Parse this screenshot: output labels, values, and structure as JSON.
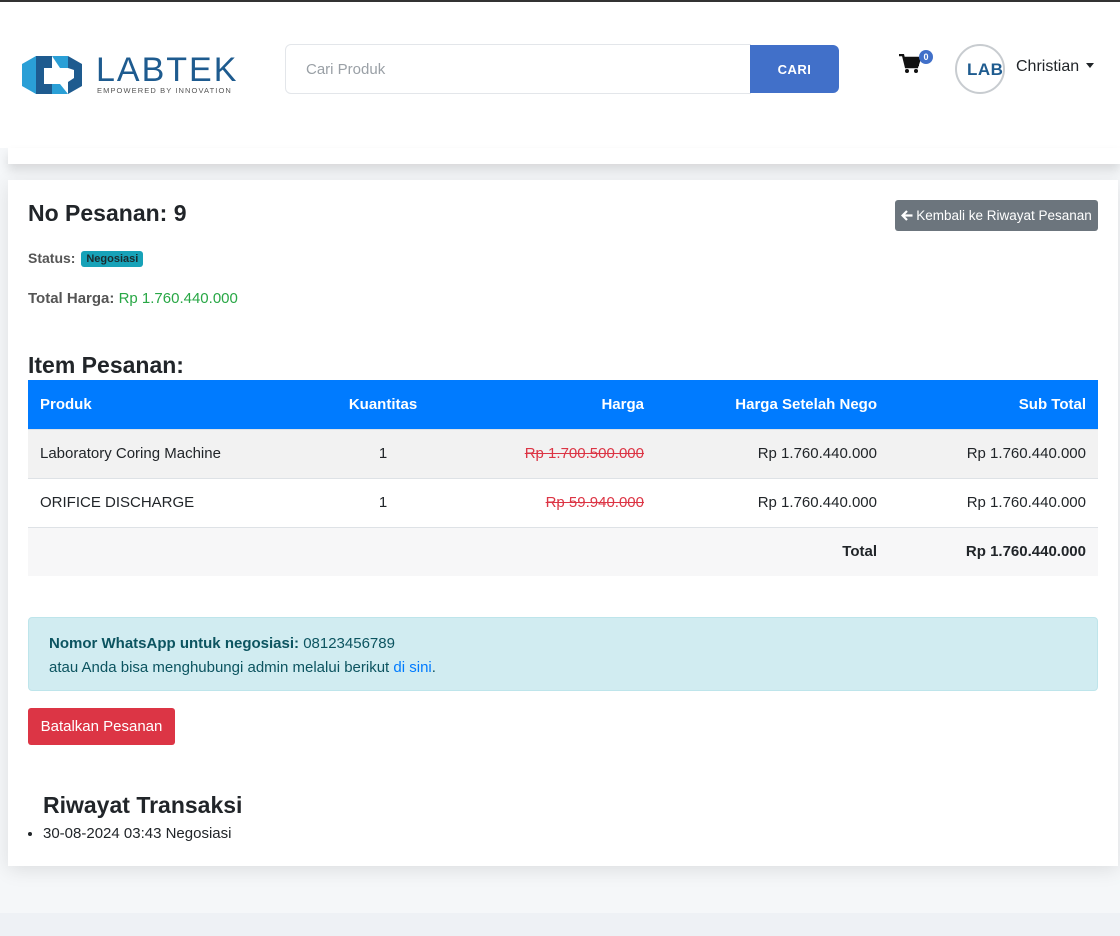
{
  "brand": {
    "name": "LABTEK",
    "tagline": "EMPOWERED BY INNOVATION",
    "color": "#1e5b8f",
    "accent": "#2a9fd6"
  },
  "header": {
    "search_placeholder": "Cari Produk",
    "search_button": "CARI",
    "cart_icon": "cart-icon",
    "cart_count": "0",
    "avatar_text": "LABT",
    "user_name": "Christian"
  },
  "order": {
    "label": "No Pesanan:",
    "number": "9",
    "back_button": "Kembali ke Riwayat Pesanan",
    "status_label": "Status:",
    "status_value": "Negosiasi",
    "total_label": "Total Harga:",
    "total_value": "Rp 1.760.440.000"
  },
  "items": {
    "title": "Item Pesanan:",
    "columns": [
      "Produk",
      "Kuantitas",
      "Harga",
      "Harga Setelah Nego",
      "Sub Total"
    ],
    "rows": [
      {
        "product": "Laboratory Coring Machine",
        "qty": "1",
        "price": "Rp 1.700.500.000",
        "nego_price": "Rp 1.760.440.000",
        "subtotal": "Rp 1.760.440.000"
      },
      {
        "product": "ORIFICE DISCHARGE",
        "qty": "1",
        "price": "Rp 59.940.000",
        "nego_price": "Rp 1.760.440.000",
        "subtotal": "Rp 1.760.440.000"
      }
    ],
    "total_label": "Total",
    "total_value": "Rp 1.760.440.000"
  },
  "negotiation": {
    "wa_label": "Nomor WhatsApp untuk negosiasi:",
    "wa_number": "08123456789",
    "contact_text": "atau Anda bisa menghubungi admin melalui berikut",
    "contact_link": "di sini",
    "contact_end": "."
  },
  "actions": {
    "cancel_button": "Batalkan Pesanan"
  },
  "history": {
    "title": "Riwayat Transaksi",
    "entries": [
      "30-08-2024 03:43 Negosiasi"
    ]
  },
  "colors": {
    "primary": "#007bff",
    "search_button": "#4170c9",
    "danger": "#dc3545",
    "secondary": "#6c757d",
    "info_badge": "#17a2b8",
    "success": "#28a745"
  }
}
